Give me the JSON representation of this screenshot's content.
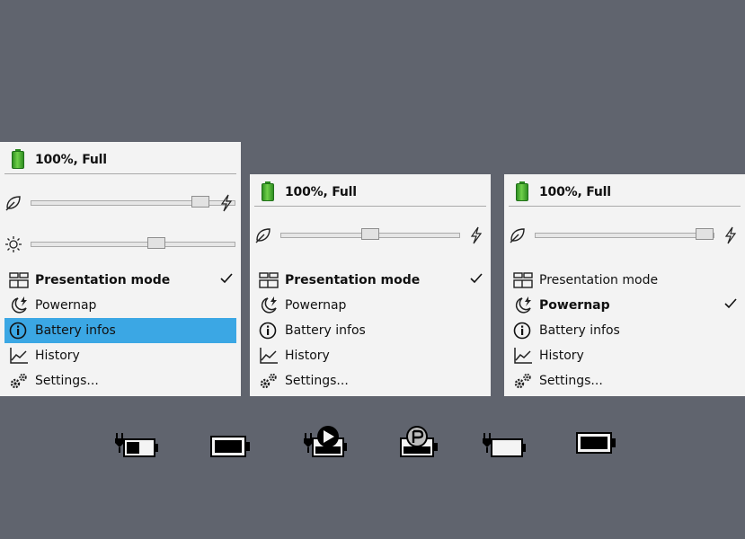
{
  "panels": [
    {
      "battery_status": "100%, Full",
      "menu": {
        "presentation_mode": "Presentation mode",
        "powernap": "Powernap",
        "battery_infos": "Battery infos",
        "history": "History",
        "settings": "Settings..."
      },
      "power_slider_level": 0.98,
      "brightness_slider_level": 0.63,
      "checked_item": "presentation_mode",
      "highlighted_item": "battery_infos"
    },
    {
      "battery_status": "100%, Full",
      "menu": {
        "presentation_mode": "Presentation mode",
        "powernap": "Powernap",
        "battery_infos": "Battery infos",
        "history": "History",
        "settings": "Settings..."
      },
      "power_slider_level": 0.5,
      "checked_item": "presentation_mode"
    },
    {
      "battery_status": "100%, Full",
      "menu": {
        "presentation_mode": "Presentation mode",
        "powernap": "Powernap",
        "battery_infos": "Battery infos",
        "history": "History",
        "settings": "Settings..."
      },
      "power_slider_level": 0.98,
      "checked_item": "powernap"
    }
  ],
  "tray_icons": [
    "battery-charging-half-icon",
    "battery-full-icon",
    "battery-charging-presentation-icon",
    "battery-powernap-icon",
    "battery-charging-empty-icon",
    "battery-full-icon"
  ],
  "colors": {
    "background": "#60646e",
    "panel": "#f3f3f3",
    "highlight": "#3ba7e4",
    "battery_green": "#3aa52a"
  }
}
